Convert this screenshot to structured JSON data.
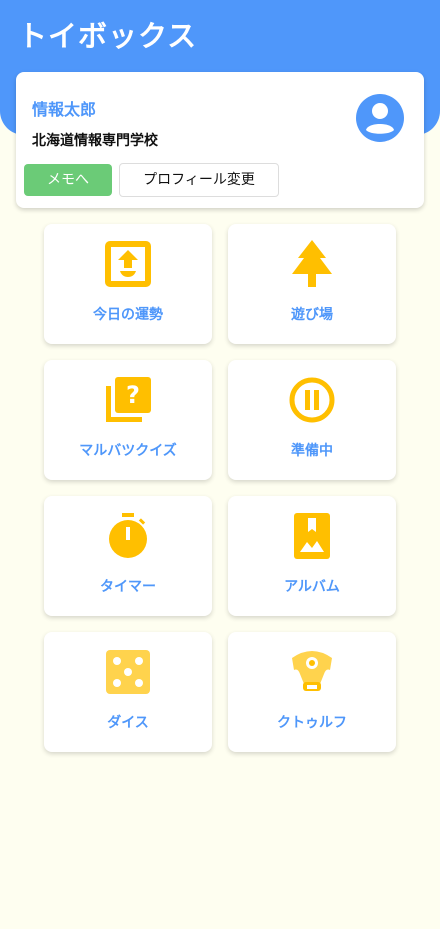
{
  "app": {
    "title": "トイボックス"
  },
  "profile": {
    "name": "情報太郎",
    "school": "北海道情報専門学校",
    "memo_button": "メモへ",
    "edit_button": "プロフィール変更"
  },
  "menu": {
    "items": [
      {
        "label": "今日の運勢",
        "icon": "fortune-inbox-icon"
      },
      {
        "label": "遊び場",
        "icon": "tree-icon"
      },
      {
        "label": "マルバツクイズ",
        "icon": "quiz-icon"
      },
      {
        "label": "準備中",
        "icon": "pause-icon"
      },
      {
        "label": "タイマー",
        "icon": "timer-icon"
      },
      {
        "label": "アルバム",
        "icon": "album-icon"
      },
      {
        "label": "ダイス",
        "icon": "dice-icon"
      },
      {
        "label": "クトゥルフ",
        "icon": "cthulhu-icon"
      }
    ]
  },
  "colors": {
    "header": "#4f97fa",
    "accent_text": "#4f97fa",
    "icon": "#ffbf00",
    "icon_light": "#ffd34d",
    "memo_button": "#6bcb77",
    "background": "#fefef0"
  }
}
